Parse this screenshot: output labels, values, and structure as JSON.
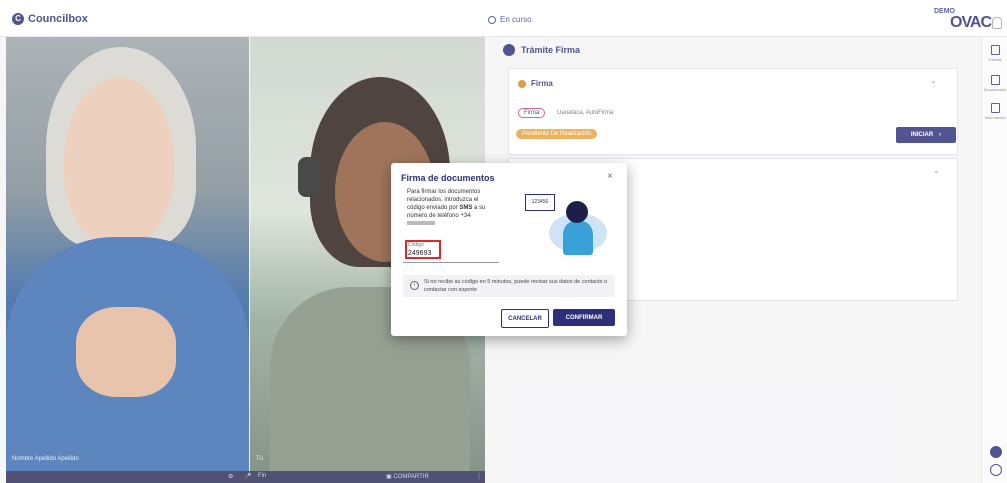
{
  "topbar": {
    "brand": "Councilbox",
    "status": "En curso",
    "demo_badge": "DEMO",
    "logo": "OVAC"
  },
  "video": {
    "participant1_name": "Nombre Apellido Apellido",
    "participant2_label": "Tú",
    "controls": {
      "pin_label": "Fin",
      "share_label": "COMPARTIR"
    }
  },
  "panel": {
    "title": "Trámite Firma",
    "firma_header": "Firma",
    "tag": "Firma",
    "tag_detail": "Uanataca, AutoFirma",
    "pending_badge": "Pendiente De Realización",
    "iniciar_button": "INICIAR"
  },
  "rightbar": {
    "items": [
      "Trámite",
      "Documentos",
      "Información"
    ]
  },
  "modal": {
    "title": "Firma de documentos",
    "body_pre": "Para firmar los documentos relacionados, introduzca el código enviado por ",
    "body_bold": "SMS",
    "body_post": " a su número de teléfono +34",
    "field_label": "Código",
    "field_value": "249693",
    "bubble_code": "123456",
    "info_text": "Si no recibe su código en 5 minutos, puede revisar sus datos de contacto o contactar con soporte",
    "cancel_button": "CANCELAR",
    "confirm_button": "CONFIRMAR"
  },
  "colors": {
    "primary": "#2c2f7a",
    "pending": "#e8a23a",
    "highlight": "#d42c2c"
  }
}
